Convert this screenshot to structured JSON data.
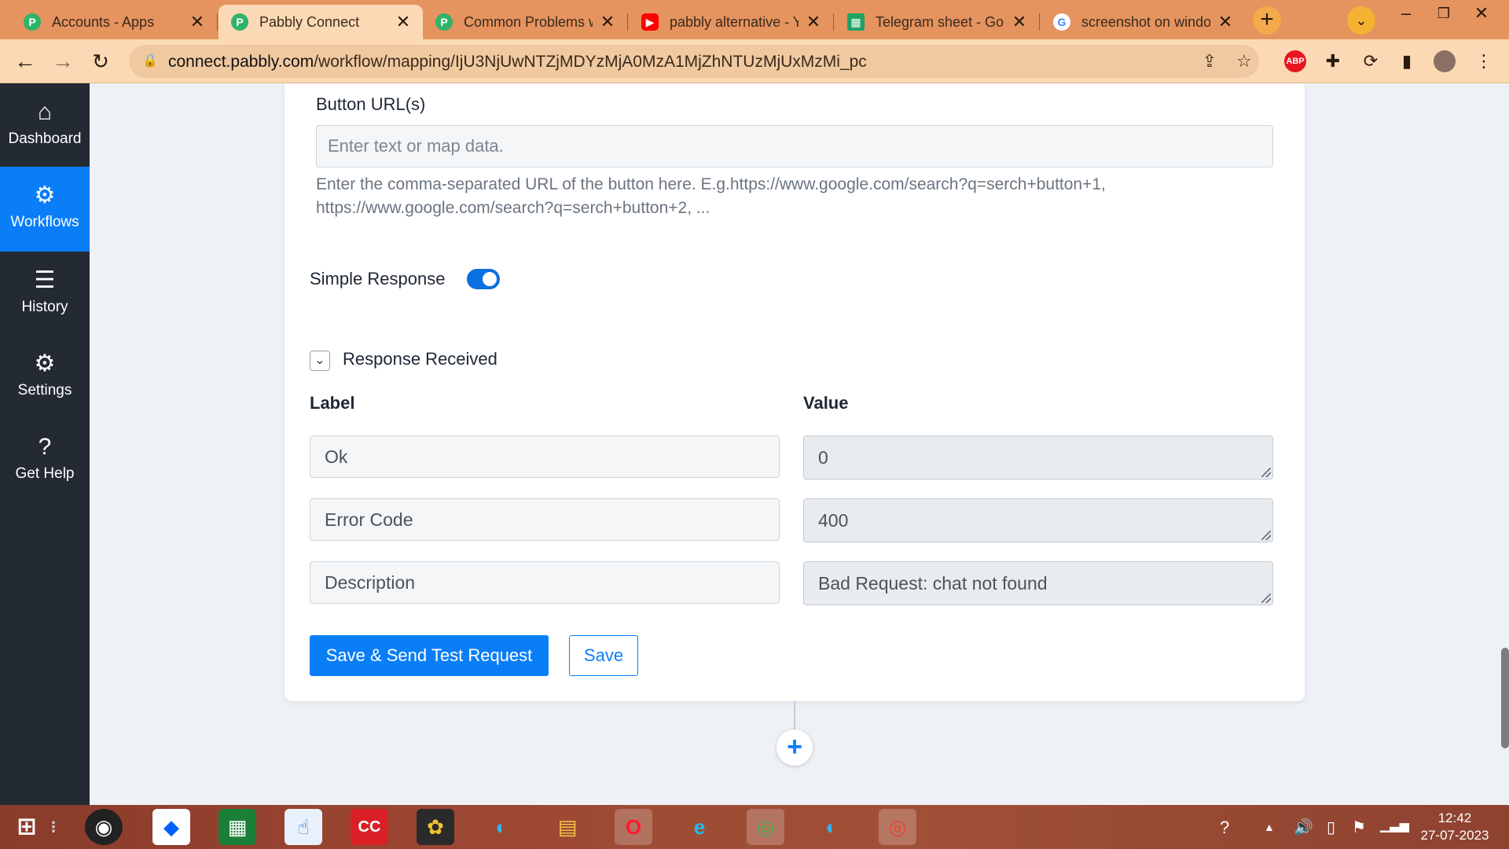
{
  "browser": {
    "tabs": [
      {
        "title": "Accounts - Apps",
        "favicon": "pabbly-icon",
        "active": false
      },
      {
        "title": "Pabbly Connect",
        "favicon": "pabbly-icon",
        "active": true
      },
      {
        "title": "Common Problems w",
        "favicon": "pabbly-icon",
        "active": false
      },
      {
        "title": "pabbly alternative - Y",
        "favicon": "youtube-icon",
        "active": false
      },
      {
        "title": "Telegram sheet - Go",
        "favicon": "sheets-icon",
        "active": false
      },
      {
        "title": "screenshot on windo",
        "favicon": "google-icon",
        "active": false
      }
    ],
    "url_host": "connect.pabbly.com",
    "url_path": "/workflow/mapping/IjU3NjUwNTZjMDYzMjA0MzA1MjZhNTUzMjUxMzMi_pc",
    "extensions": [
      "share-icon",
      "star-icon",
      "adblock-plus-icon",
      "puzzle-icon",
      "sync-icon",
      "side-panel-icon",
      "profile-avatar",
      "kebab-menu-icon"
    ]
  },
  "sidebar": {
    "items": [
      {
        "label": "Dashboard",
        "icon": "home-icon",
        "active": false
      },
      {
        "label": "Workflows",
        "icon": "workflow-icon",
        "active": true
      },
      {
        "label": "History",
        "icon": "list-icon",
        "active": false
      },
      {
        "label": "Settings",
        "icon": "gear-icon",
        "active": false
      },
      {
        "label": "Get Help",
        "icon": "help-icon",
        "active": false
      }
    ]
  },
  "form": {
    "button_urls": {
      "label": "Button URL(s)",
      "placeholder": "Enter text or map data.",
      "help": "Enter the comma-separated URL of the button here. E.g.https://www.google.com/search?q=serch+button+1, https://www.google.com/search?q=serch+button+2, ..."
    },
    "simple_response": {
      "label": "Simple Response",
      "enabled": true
    },
    "response_received": {
      "title": "Response Received",
      "col_label": "Label",
      "col_value": "Value",
      "rows": [
        {
          "label": "Ok",
          "value": "0"
        },
        {
          "label": "Error Code",
          "value": "400"
        },
        {
          "label": "Description",
          "value": "Bad Request: chat not found"
        }
      ]
    },
    "buttons": {
      "send": "Save & Send Test Request",
      "save": "Save"
    },
    "add_step_symbol": "+"
  },
  "colors": {
    "accent": "#0a7ef7",
    "sidebar_bg": "#232a33",
    "tabbar_bg": "#e5935f",
    "toolbar_bg": "#fbd9b4"
  },
  "taskbar": {
    "apps": [
      "windows-start-icon",
      "task-view-icon",
      "camera-app-icon",
      "dropbox-icon",
      "store-icon",
      "touch-app-icon",
      "creative-cloud-icon",
      "photos-app-icon",
      "edge-icon",
      "file-explorer-icon",
      "opera-icon",
      "internet-explorer-icon",
      "chrome-profile-icon",
      "edge-beta-icon",
      "chrome-icon"
    ],
    "time": "12:42",
    "date": "27-07-2023"
  }
}
